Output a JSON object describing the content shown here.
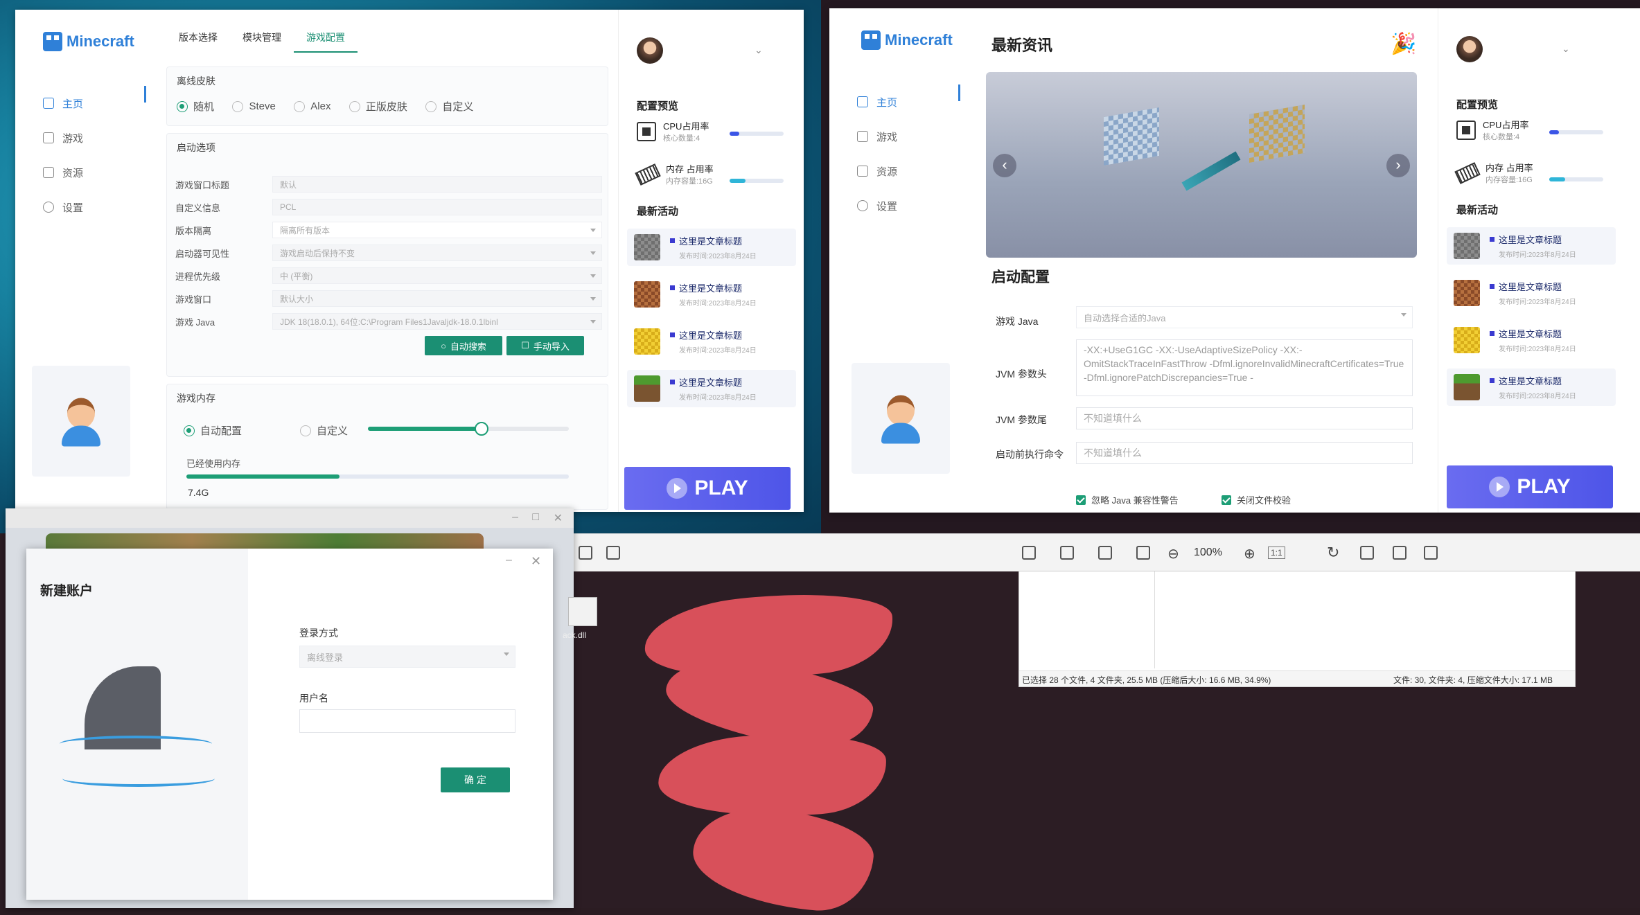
{
  "app": {
    "logo": "Minecraft"
  },
  "nav": [
    {
      "label": "主页"
    },
    {
      "label": "游戏"
    },
    {
      "label": "资源"
    },
    {
      "label": "设置"
    }
  ],
  "left_window": {
    "tabs": [
      "版本选择",
      "模块管理",
      "游戏配置"
    ],
    "skin": {
      "title": "离线皮肤",
      "options": [
        "随机",
        "Steve",
        "Alex",
        "正版皮肤",
        "自定义"
      ],
      "selected": "随机"
    },
    "launch": {
      "title": "启动选项",
      "fields": [
        {
          "label": "游戏窗口标题",
          "value": "默认"
        },
        {
          "label": "自定义信息",
          "value": "PCL"
        },
        {
          "label": "版本隔离",
          "value": "隔离所有版本"
        },
        {
          "label": "启动器可见性",
          "value": "游戏启动后保持不变"
        },
        {
          "label": "进程优先级",
          "value": "中 (平衡)"
        },
        {
          "label": "游戏窗口",
          "value": "默认大小"
        },
        {
          "label": "游戏 Java",
          "value": "JDK 18(18.0.1), 64位:C:\\Program Files1Javaljdk-18.0.1lbinl"
        }
      ],
      "auto_search": "自动搜索",
      "manual_import": "手动导入"
    },
    "memory": {
      "title": "游戏内存",
      "auto": "自动配置",
      "custom": "自定义",
      "slider_fraction": 0.56,
      "used_label": "已经使用内存",
      "used_fraction": 0.4,
      "used_value": "7.4G"
    }
  },
  "right_window": {
    "news_title": "最新资讯",
    "launch_config_title": "启动配置",
    "fields": [
      {
        "label": "游戏 Java",
        "value": "自动选择合适的Java"
      },
      {
        "label": "JVM 参数头",
        "value": "-XX:+UseG1GC -XX:-UseAdaptiveSizePolicy -XX:-OmitStackTraceInFastThrow -Dfml.ignoreInvalidMinecraftCertificates=True -Dfml.ignorePatchDiscrepancies=True -"
      },
      {
        "label": "JVM 参数尾",
        "value": "不知道填什么"
      },
      {
        "label": "启动前执行命令",
        "value": "不知道填什么"
      }
    ],
    "checks": [
      "忽略 Java 兼容性警告",
      "关闭文件校验"
    ]
  },
  "sidebar_right": {
    "config_preview": "配置预览",
    "cpu": {
      "title": "CPU占用率",
      "sub": "核心数量:4",
      "fraction": 0.18
    },
    "mem": {
      "title": "内存 占用率",
      "sub": "内存容量:16G",
      "fraction": 0.3
    },
    "activity": "最新活动",
    "news": [
      {
        "title": "这里是文章标题",
        "date": "发布时间:2023年8月24日"
      },
      {
        "title": "这里是文章标题",
        "date": "发布时间:2023年8月24日"
      },
      {
        "title": "这里是文章标题",
        "date": "发布时间:2023年8月24日"
      },
      {
        "title": "这里是文章标题",
        "date": "发布时间:2023年8月24日"
      }
    ],
    "play": "PLAY"
  },
  "dialog": {
    "title": "新建账户",
    "login_label": "登录方式",
    "login_value": "离线登录",
    "user_label": "用户名",
    "user_value": "",
    "confirm": "确 定"
  },
  "viewer": {
    "zoom": "100%",
    "ratio": "1:1"
  },
  "explorer": {
    "status_left": "已选择 28 个文件, 4 文件夹, 25.5 MB (压缩后大小: 16.6 MB, 34.9%)",
    "status_right": "文件: 30, 文件夹: 4, 压缩文件大小: 17.1 MB"
  },
  "desktop": {
    "file_label": "ack.dll"
  },
  "colors": {
    "accent": "#1b8f73",
    "brand": "#2f80d8",
    "play": "#5b5ff0"
  }
}
